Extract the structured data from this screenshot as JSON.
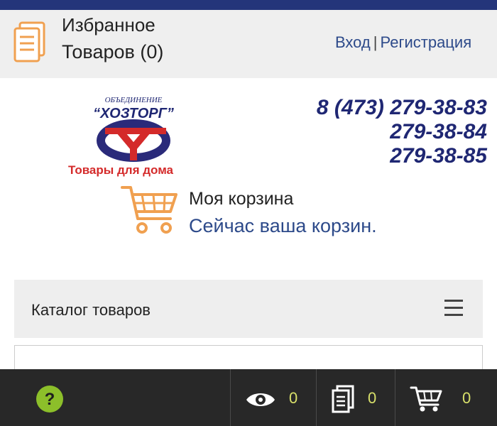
{
  "header": {
    "favorites_line1": "Избранное",
    "favorites_line2": "Товаров (0)",
    "login": "Вход",
    "separator": "|",
    "register": "Регистрация"
  },
  "logo": {
    "tagline": "Товары для дома"
  },
  "phones": [
    "8 (473) 279-38-83",
    "279-38-84",
    "279-38-85"
  ],
  "cart": {
    "title": "Моя корзина",
    "status": "Сейчас ваша корзин."
  },
  "catalog": {
    "label": "Каталог товаров"
  },
  "bottom": {
    "views_count": "0",
    "compare_count": "0",
    "cart_count": "0"
  },
  "colors": {
    "topbar": "#24357a",
    "link": "#2d4a8a",
    "phone": "#1f2773",
    "accent_orange": "#f0a050",
    "help_green": "#8cbf2a",
    "counter": "#d8e06a"
  }
}
